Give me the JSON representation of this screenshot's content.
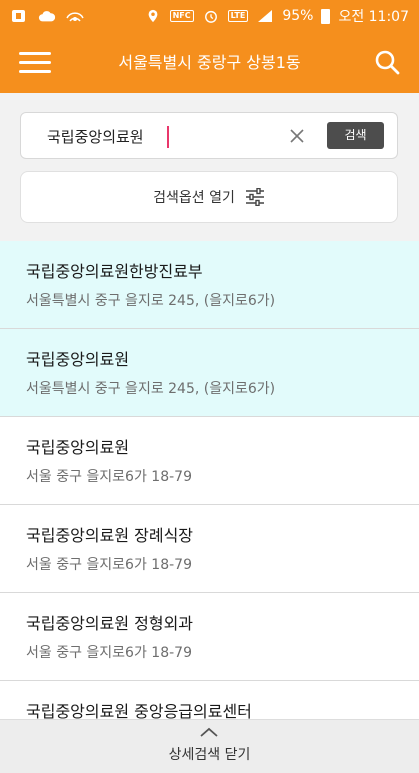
{
  "status_bar": {
    "battery": "95%",
    "time": "오전 11:07",
    "icons": [
      "notification-app-icon",
      "cloud-icon",
      "wifi-hotspot-icon",
      "location-icon",
      "nfc-icon",
      "alarm-icon",
      "lte-icon",
      "signal-icon",
      "battery-icon"
    ],
    "nfc_label": "NFC",
    "lte_label": "LTE"
  },
  "header": {
    "title": "서울특별시 중랑구 상봉1동",
    "menu_icon": "hamburger-menu-icon",
    "search_icon": "search-icon"
  },
  "search": {
    "value": "국립중앙의료원",
    "clear_icon": "close-icon",
    "button_label": "검색"
  },
  "options": {
    "label": "검색옵션 열기",
    "icon": "sliders-icon"
  },
  "results": [
    {
      "name": "국립중앙의료원한방진료부",
      "address": "서울특별시 중구 을지로 245, (을지로6가)",
      "highlighted": true
    },
    {
      "name": "국립중앙의료원",
      "address": "서울특별시 중구 을지로 245, (을지로6가)",
      "highlighted": true
    },
    {
      "name": "국립중앙의료원",
      "address": "서울 중구 을지로6가 18-79",
      "highlighted": false
    },
    {
      "name": "국립중앙의료원 장례식장",
      "address": "서울 중구 을지로6가 18-79",
      "highlighted": false
    },
    {
      "name": "국립중앙의료원 정형외과",
      "address": "서울 중구 을지로6가 18-79",
      "highlighted": false
    },
    {
      "name": "국립중앙의료원 중앙응급의료센터",
      "address": "",
      "highlighted": false
    }
  ],
  "bottom_bar": {
    "label": "상세검색 닫기",
    "icon": "chevron-up-icon"
  },
  "colors": {
    "accent": "#f58f1d",
    "highlight_row": "#e2fbfb",
    "caret": "#e9376b",
    "search_button": "#4d4d4d"
  }
}
